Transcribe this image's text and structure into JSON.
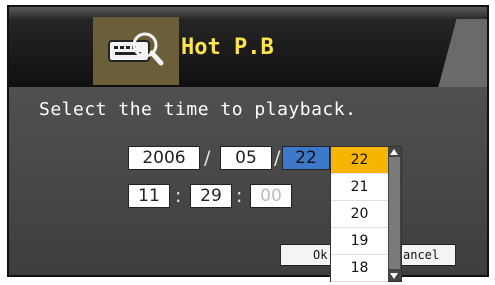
{
  "header": {
    "title": "Hot P.B",
    "icon": "keyboard-search-icon"
  },
  "dialog": {
    "prompt": "Select the time to playback."
  },
  "date": {
    "year": "2006",
    "month": "05",
    "day": "22",
    "sep1": "/",
    "sep2": "/"
  },
  "time": {
    "hour": "11",
    "minute": "29",
    "second": "00",
    "sep1": ":",
    "sep2": ":"
  },
  "buttons": {
    "ok_label": "Ok",
    "cancel_label": "ancel"
  },
  "day_dropdown": {
    "options": [
      "22",
      "21",
      "20",
      "19",
      "18"
    ],
    "selected": "22"
  },
  "colors": {
    "title": "#ffe44a",
    "active_field": "#3d79c8",
    "selected_option": "#f7b400"
  }
}
